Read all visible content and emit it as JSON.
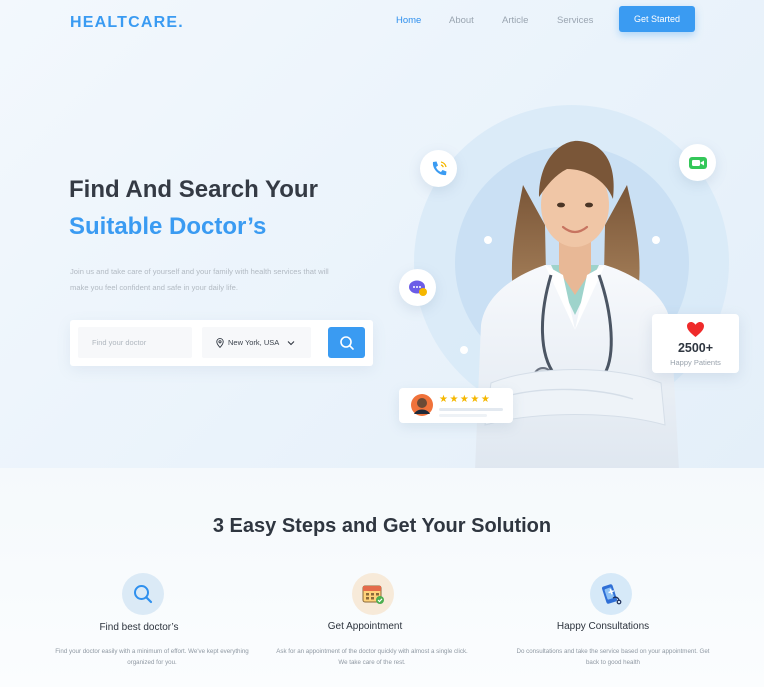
{
  "nav": {
    "logo": "HEALTCARE",
    "logo_dot": ".",
    "links": [
      "Home",
      "About",
      "Article",
      "Services"
    ],
    "cta": "Get Started"
  },
  "hero": {
    "headline_1": "Find And Search Your",
    "headline_2": "Suitable Doctor’s",
    "subtext": "Join us and take care of yourself and your family with health services that will make you feel confident and safe in your daily life."
  },
  "search": {
    "placeholder": "Find your doctor",
    "location": "New York, USA"
  },
  "stats": {
    "count": "2500+",
    "label": "Happy Patients"
  },
  "review": {
    "stars": "★★★★★",
    "rating": 5
  },
  "steps": {
    "title": "3 Easy Steps and Get Your Solution",
    "items": [
      {
        "title": "Find best doctor’s",
        "desc": "Find your doctor easily with a minimum of effort. We've kept everything organized for you."
      },
      {
        "title": "Get Appointment",
        "desc": "Ask for an appointment of the doctor quickly with almost a single click. We take care of the rest."
      },
      {
        "title": "Happy Consultations",
        "desc": "Do consultations and  take the service based on your appointment. Get back to good health"
      }
    ]
  },
  "colors": {
    "accent": "#3a9bf2",
    "heading": "#343a44",
    "muted": "#b2bac3"
  },
  "icons": [
    "search-icon",
    "location-pin-icon",
    "chevron-down-icon",
    "phone-icon",
    "video-icon",
    "chat-icon",
    "heart-icon",
    "star-icon",
    "calendar-icon",
    "mobile-medical-icon"
  ]
}
